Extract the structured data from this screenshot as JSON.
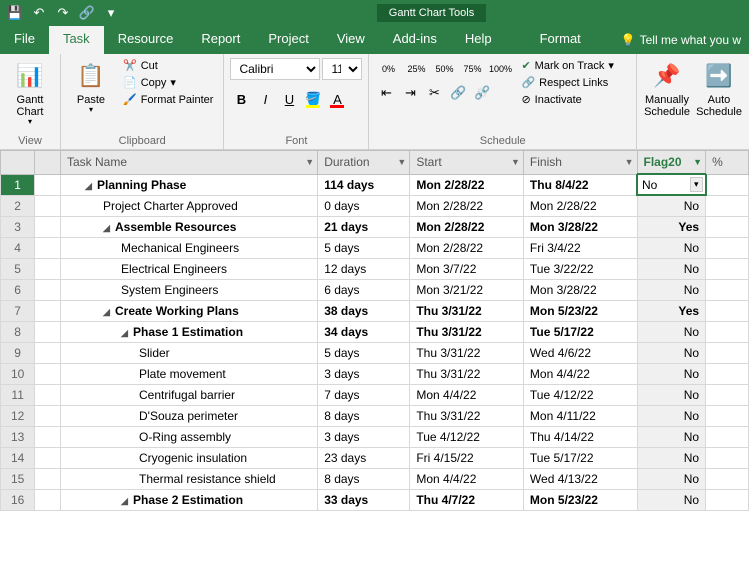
{
  "qat": {
    "save": "💾",
    "undo": "↶",
    "redo": "↷",
    "link": "🔗"
  },
  "tool_context": "Gantt Chart Tools",
  "tabs": [
    "File",
    "Task",
    "Resource",
    "Report",
    "Project",
    "View",
    "Add-ins",
    "Help",
    "Format"
  ],
  "active_tab": "Task",
  "tell_me": "Tell me what you w",
  "ribbon": {
    "view": {
      "gantt": "Gantt Chart",
      "label": "View"
    },
    "clipboard": {
      "paste": "Paste",
      "cut": "Cut",
      "copy": "Copy",
      "format_painter": "Format Painter",
      "label": "Clipboard"
    },
    "font": {
      "name": "Calibri",
      "size": "11",
      "label": "Font"
    },
    "schedule": {
      "percents": [
        "0%",
        "25%",
        "50%",
        "75%",
        "100%"
      ],
      "mark_on_track": "Mark on Track",
      "respect_links": "Respect Links",
      "inactivate": "Inactivate",
      "label": "Schedule"
    },
    "tasks_group": {
      "manually": "Manually Schedule",
      "auto": "Auto Schedule"
    }
  },
  "columns": {
    "task_name": "Task Name",
    "duration": "Duration",
    "start": "Start",
    "finish": "Finish",
    "flag20": "Flag20",
    "pct": "%"
  },
  "rows": [
    {
      "n": 1,
      "lvl": 1,
      "sum": true,
      "name": "Planning Phase",
      "dur": "114 days",
      "start": "Mon 2/28/22",
      "finish": "Thu 8/4/22",
      "flag": "No",
      "sel": true
    },
    {
      "n": 2,
      "lvl": 2,
      "sum": false,
      "name": "Project Charter Approved",
      "dur": "0 days",
      "start": "Mon 2/28/22",
      "finish": "Mon 2/28/22",
      "flag": "No"
    },
    {
      "n": 3,
      "lvl": 2,
      "sum": true,
      "name": "Assemble Resources",
      "dur": "21 days",
      "start": "Mon 2/28/22",
      "finish": "Mon 3/28/22",
      "flag": "Yes"
    },
    {
      "n": 4,
      "lvl": 3,
      "sum": false,
      "name": "Mechanical Engineers",
      "dur": "5 days",
      "start": "Mon 2/28/22",
      "finish": "Fri 3/4/22",
      "flag": "No"
    },
    {
      "n": 5,
      "lvl": 3,
      "sum": false,
      "name": "Electrical Engineers",
      "dur": "12 days",
      "start": "Mon 3/7/22",
      "finish": "Tue 3/22/22",
      "flag": "No"
    },
    {
      "n": 6,
      "lvl": 3,
      "sum": false,
      "name": "System Engineers",
      "dur": "6 days",
      "start": "Mon 3/21/22",
      "finish": "Mon 3/28/22",
      "flag": "No"
    },
    {
      "n": 7,
      "lvl": 2,
      "sum": true,
      "name": "Create Working Plans",
      "dur": "38 days",
      "start": "Thu 3/31/22",
      "finish": "Mon 5/23/22",
      "flag": "Yes"
    },
    {
      "n": 8,
      "lvl": 3,
      "sum": true,
      "name": "Phase 1 Estimation",
      "dur": "34 days",
      "start": "Thu 3/31/22",
      "finish": "Tue 5/17/22",
      "flag": "No"
    },
    {
      "n": 9,
      "lvl": 4,
      "sum": false,
      "name": "Slider",
      "dur": "5 days",
      "start": "Thu 3/31/22",
      "finish": "Wed 4/6/22",
      "flag": "No"
    },
    {
      "n": 10,
      "lvl": 4,
      "sum": false,
      "name": "Plate movement",
      "dur": "3 days",
      "start": "Thu 3/31/22",
      "finish": "Mon 4/4/22",
      "flag": "No"
    },
    {
      "n": 11,
      "lvl": 4,
      "sum": false,
      "name": "Centrifugal barrier",
      "dur": "7 days",
      "start": "Mon 4/4/22",
      "finish": "Tue 4/12/22",
      "flag": "No"
    },
    {
      "n": 12,
      "lvl": 4,
      "sum": false,
      "name": "D'Souza perimeter",
      "dur": "8 days",
      "start": "Thu 3/31/22",
      "finish": "Mon 4/11/22",
      "flag": "No"
    },
    {
      "n": 13,
      "lvl": 4,
      "sum": false,
      "name": "O-Ring assembly",
      "dur": "3 days",
      "start": "Tue 4/12/22",
      "finish": "Thu 4/14/22",
      "flag": "No"
    },
    {
      "n": 14,
      "lvl": 4,
      "sum": false,
      "name": "Cryogenic insulation",
      "dur": "23 days",
      "start": "Fri 4/15/22",
      "finish": "Tue 5/17/22",
      "flag": "No"
    },
    {
      "n": 15,
      "lvl": 4,
      "sum": false,
      "name": "Thermal resistance shield",
      "dur": "8 days",
      "start": "Mon 4/4/22",
      "finish": "Wed 4/13/22",
      "flag": "No"
    },
    {
      "n": 16,
      "lvl": 3,
      "sum": true,
      "name": "Phase 2 Estimation",
      "dur": "33 days",
      "start": "Thu 4/7/22",
      "finish": "Mon 5/23/22",
      "flag": "No"
    }
  ]
}
